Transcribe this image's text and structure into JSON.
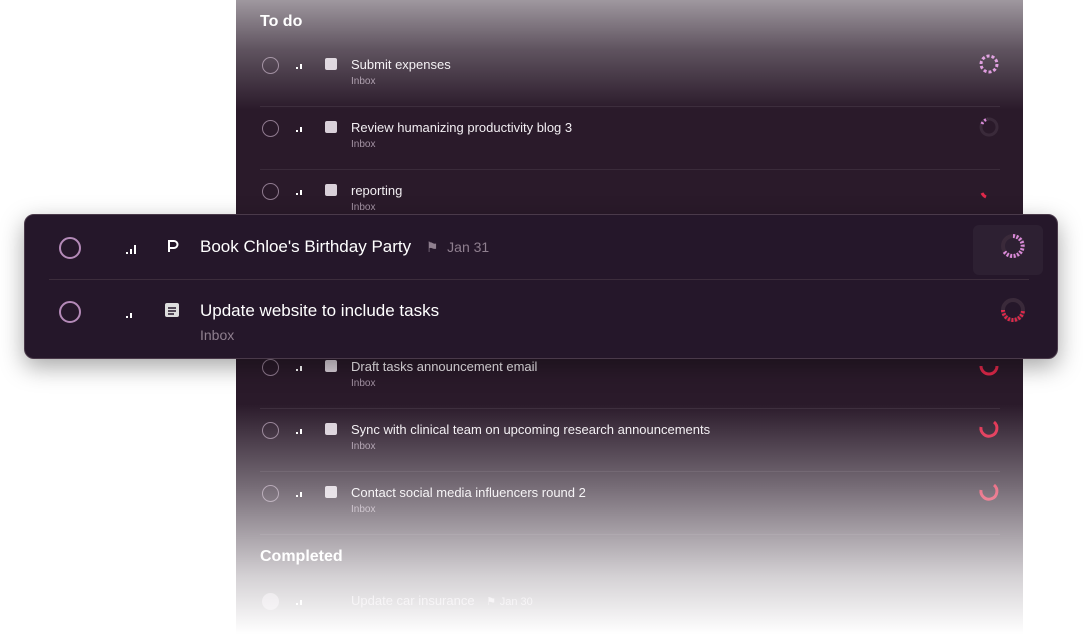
{
  "sections": {
    "todo_title": "To do",
    "completed_title": "Completed"
  },
  "tasks": [
    {
      "title": "Submit expenses",
      "project": "Inbox"
    },
    {
      "title": "Review humanizing productivity blog 3",
      "project": "Inbox"
    },
    {
      "title": "reporting",
      "project": "Inbox"
    },
    {
      "title": "Draft tasks announcement email",
      "project": "Inbox"
    },
    {
      "title": "Sync with clinical team on upcoming research announcements",
      "project": "Inbox"
    },
    {
      "title": "Contact social media influencers round 2",
      "project": "Inbox"
    }
  ],
  "completed": [
    {
      "title": "Update car insurance",
      "date": "Jan 30"
    }
  ],
  "card": {
    "task1": {
      "title": "Book Chloe's Birthday Party",
      "date": "Jan 31",
      "project_icon": "p-logo-icon",
      "flag_icon": "flag-icon"
    },
    "task2": {
      "title": "Update website to include tasks",
      "project": "Inbox",
      "project_icon": "inbox-icon"
    }
  },
  "colors": {
    "panel_bg": "#2a1a2a",
    "card_bg": "#25172a",
    "ring_pink": "#d98ad9",
    "ring_red": "#e0284a"
  }
}
